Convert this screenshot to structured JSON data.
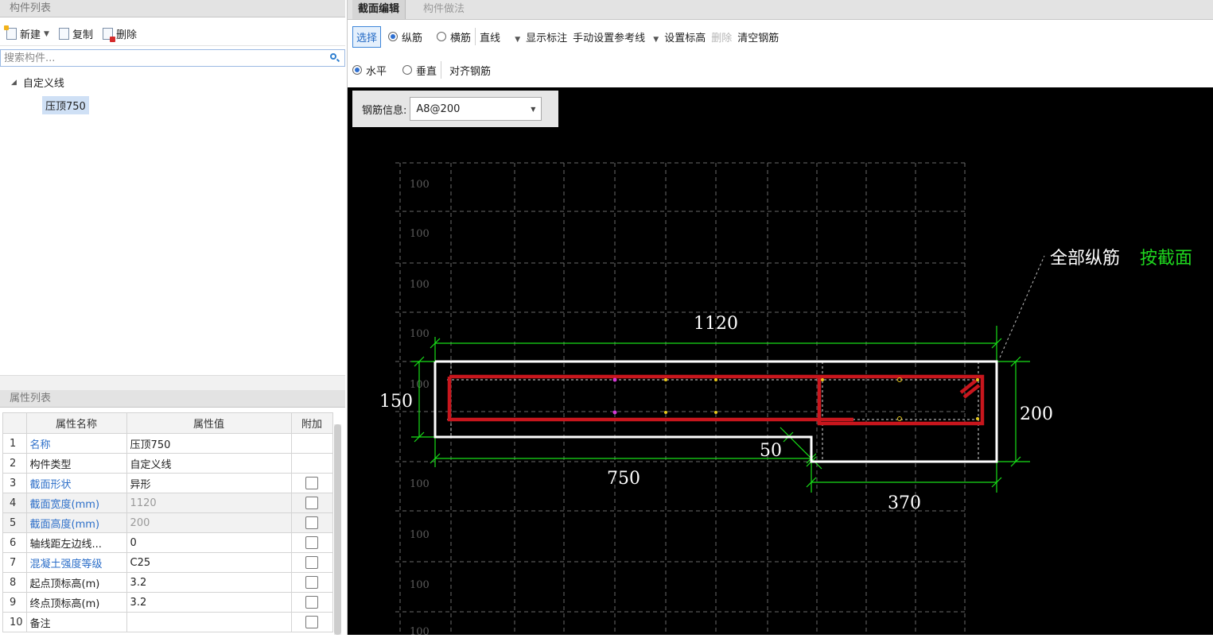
{
  "component_list": {
    "title": "构件列表",
    "toolbar": {
      "new": "新建",
      "copy": "复制",
      "delete": "删除"
    },
    "search_placeholder": "搜索构件...",
    "tree": {
      "group": "自定义线",
      "item": "压顶750"
    }
  },
  "property_list": {
    "title": "属性列表",
    "headers": [
      "属性名称",
      "属性值",
      "附加"
    ],
    "rows": [
      {
        "n": "1",
        "name": "名称",
        "value": "压顶750",
        "blue": true,
        "check": false
      },
      {
        "n": "2",
        "name": "构件类型",
        "value": "自定义线",
        "blue": false,
        "check": false
      },
      {
        "n": "3",
        "name": "截面形状",
        "value": "异形",
        "blue": true,
        "check": true
      },
      {
        "n": "4",
        "name": "截面宽度(mm)",
        "value": "1120",
        "blue": true,
        "check": true,
        "grey": true
      },
      {
        "n": "5",
        "name": "截面高度(mm)",
        "value": "200",
        "blue": true,
        "check": true,
        "grey": true
      },
      {
        "n": "6",
        "name": "轴线距左边线...",
        "value": "0",
        "blue": false,
        "check": true
      },
      {
        "n": "7",
        "name": "混凝土强度等级",
        "value": "C25",
        "blue": true,
        "check": true
      },
      {
        "n": "8",
        "name": "起点顶标高(m)",
        "value": "3.2",
        "blue": false,
        "check": true
      },
      {
        "n": "9",
        "name": "终点顶标高(m)",
        "value": "3.2",
        "blue": false,
        "check": true
      },
      {
        "n": "10",
        "name": "备注",
        "value": "",
        "blue": false,
        "check": true
      }
    ]
  },
  "tabs": [
    "截面编辑",
    "构件做法"
  ],
  "toolbar1": {
    "select": "选择",
    "longitudinal": "纵筋",
    "transverse": "横筋",
    "line_type": "直线",
    "show_annotation": "显示标注",
    "manual_ref_line": "手动设置参考线",
    "set_elevation": "设置标高",
    "delete": "删除",
    "clear_rebar": "清空钢筋"
  },
  "toolbar2": {
    "horizontal": "水平",
    "vertical": "垂直",
    "align_rebar": "对齐钢筋"
  },
  "rebar_info": {
    "label": "钢筋信息:",
    "value": "A8@200"
  },
  "drawing": {
    "grid_label": "100",
    "dim_width": "1120",
    "dim_height_left": "150",
    "dim_height_right": "200",
    "dim_step": "50",
    "dim_bottom_left": "750",
    "dim_bottom_right": "370",
    "annotation_prefix": "全部纵筋",
    "annotation_value": "按截面",
    "colors": {
      "outline": "#ffffff",
      "rebar": "#c8161d",
      "dimension": "#18e018",
      "grid": "#6a6a6a",
      "annotation_value": "#1fd81f"
    }
  }
}
